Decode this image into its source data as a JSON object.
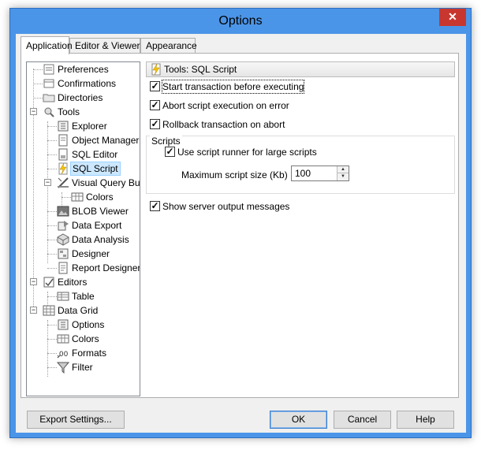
{
  "window": {
    "title": "Options",
    "close_glyph": "✕"
  },
  "tabs": [
    {
      "label": "Application",
      "active": true
    },
    {
      "label": "Editor & Viewers",
      "active": false
    },
    {
      "label": "Appearance",
      "active": false
    }
  ],
  "tree": [
    {
      "label": "Preferences",
      "icon": "preferences-icon"
    },
    {
      "label": "Confirmations",
      "icon": "confirmations-icon"
    },
    {
      "label": "Directories",
      "icon": "folder-icon"
    },
    {
      "label": "Tools",
      "icon": "tools-icon",
      "expanded": true
    },
    {
      "label": "Explorer",
      "icon": "explorer-icon"
    },
    {
      "label": "Object Manager",
      "icon": "object-manager-icon"
    },
    {
      "label": "SQL Editor",
      "icon": "sql-editor-icon"
    },
    {
      "label": "SQL Script",
      "icon": "sql-script-icon",
      "selected": true
    },
    {
      "label": "Visual Query Build",
      "icon": "visual-query-icon",
      "expanded": true
    },
    {
      "label": "Colors",
      "icon": "colors-icon"
    },
    {
      "label": "BLOB Viewer",
      "icon": "blob-viewer-icon"
    },
    {
      "label": "Data Export",
      "icon": "data-export-icon"
    },
    {
      "label": "Data Analysis",
      "icon": "data-analysis-icon"
    },
    {
      "label": "Designer",
      "icon": "designer-icon"
    },
    {
      "label": "Report Designer",
      "icon": "report-designer-icon"
    },
    {
      "label": "Editors",
      "icon": "editors-icon",
      "expanded": true
    },
    {
      "label": "Table",
      "icon": "table-icon"
    },
    {
      "label": "Data Grid",
      "icon": "data-grid-icon",
      "expanded": true
    },
    {
      "label": "Options",
      "icon": "options-icon"
    },
    {
      "label": "Colors",
      "icon": "grid-colors-icon"
    },
    {
      "label": "Formats",
      "icon": "formats-icon"
    },
    {
      "label": "Filter",
      "icon": "filter-icon"
    }
  ],
  "panel": {
    "header": "Tools: SQL Script",
    "options": {
      "start_transaction": {
        "label": "Start transaction before executing",
        "checked": true
      },
      "abort_on_error": {
        "label": "Abort script execution on error",
        "checked": true
      },
      "rollback_on_abort": {
        "label": "Rollback transaction on abort",
        "checked": true
      },
      "show_server_output": {
        "label": "Show server output messages",
        "checked": true
      }
    },
    "scripts_group": {
      "title": "Scripts",
      "use_runner": {
        "label": "Use script runner for large scripts",
        "checked": true
      },
      "max_size_label": "Maximum script size (Kb)",
      "max_size_value": "100"
    }
  },
  "buttons": {
    "export": "Export Settings...",
    "ok": "OK",
    "cancel": "Cancel",
    "help": "Help"
  },
  "check_glyph": "✓"
}
